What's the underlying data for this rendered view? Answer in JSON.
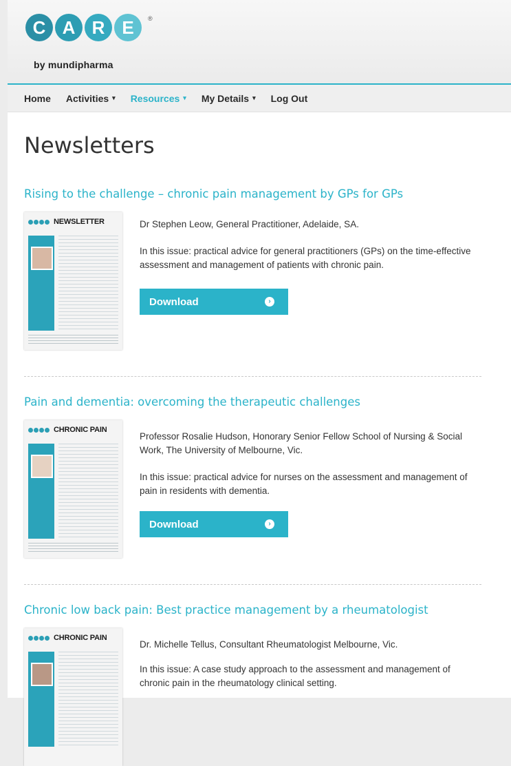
{
  "brand": {
    "logo_letters": [
      "C",
      "A",
      "R",
      "E"
    ],
    "registered_mark": "®",
    "subtitle": "by mundipharma"
  },
  "nav": {
    "items": [
      {
        "label": "Home",
        "caret": ""
      },
      {
        "label": "Activities",
        "caret": "▾"
      },
      {
        "label": "Resources",
        "caret": "▾"
      },
      {
        "label": "My Details",
        "caret": "▾"
      },
      {
        "label": "Log Out",
        "caret": ""
      }
    ],
    "active_index": 2
  },
  "page": {
    "title": "Newsletters"
  },
  "colors": {
    "accent": "#2bb3c9",
    "text": "#333333"
  },
  "articles": [
    {
      "title": "Rising to the challenge – chronic pain management by GPs for GPs",
      "thumb_word": "NEWSLETTER",
      "author": "Dr Stephen Leow, General Practitioner, Adelaide, SA.",
      "description": "In this issue: practical advice for general practitioners (GPs) on the time-effective assessment and management of patients with chronic pain.",
      "button_label": "Download",
      "button_icon": "arrow-right-circle-icon"
    },
    {
      "title": "Pain and dementia: overcoming the therapeutic challenges",
      "thumb_word": "CHRONIC PAIN",
      "author": "Professor Rosalie Hudson, Honorary Senior Fellow School of Nursing & Social Work, The University of Melbourne, Vic.",
      "description": "In this issue: practical advice for nurses on the assessment and management of pain in residents with dementia.",
      "button_label": "Download",
      "button_icon": "arrow-right-circle-icon"
    },
    {
      "title": "Chronic low back pain: Best practice management by a rheumatologist",
      "thumb_word": "CHRONIC PAIN",
      "author": "Dr. Michelle Tellus, Consultant Rheumatologist Melbourne, Vic.",
      "description": "In this issue: A case study approach to the assessment and management of chronic pain in the rheumatology clinical setting."
    }
  ]
}
